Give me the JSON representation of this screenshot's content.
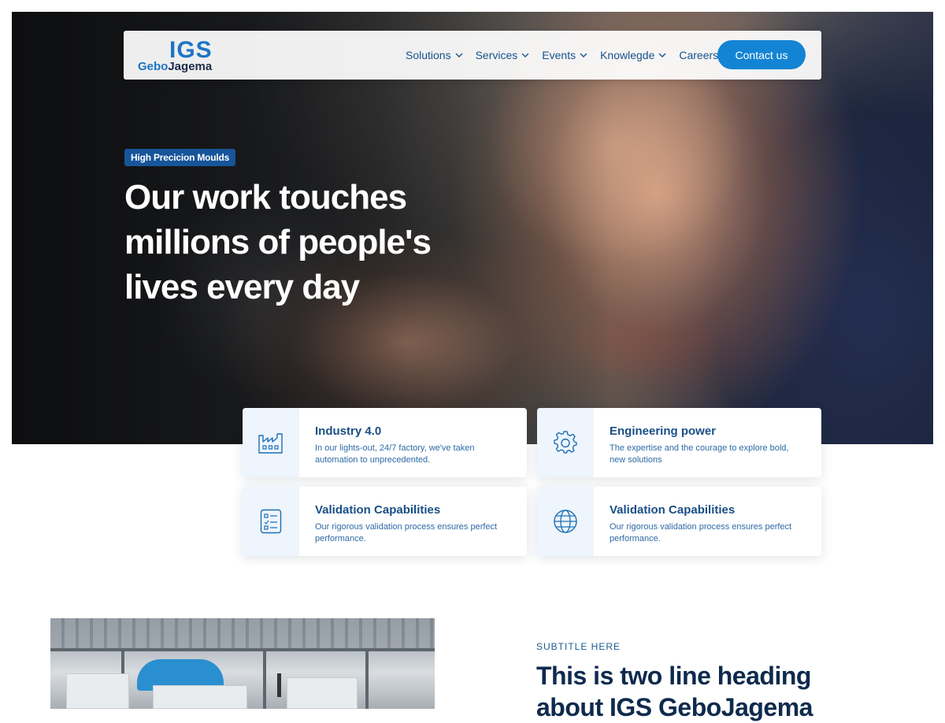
{
  "header": {
    "logo_mark": "IGS",
    "logo_word_part1": "Gebo",
    "logo_word_part2": "Jagema",
    "nav": [
      {
        "label": "Solutions"
      },
      {
        "label": "Services"
      },
      {
        "label": "Events"
      },
      {
        "label": "Knowlegde"
      },
      {
        "label": "Careers"
      }
    ],
    "contact_label": "Contact us"
  },
  "hero": {
    "badge": "High Precicion Moulds",
    "title": "Our work touches millions of people's lives every day"
  },
  "features": [
    {
      "title": "Industry 4.0",
      "description": "In our lights-out, 24/7 factory, we've taken automation to unprecedented.",
      "icon": "factory-icon"
    },
    {
      "title": "Engineering power",
      "description": "The expertise and the courage to explore bold, new solutions",
      "icon": "gear-icon"
    },
    {
      "title": "Validation Capabilities",
      "description": "Our rigorous validation process ensures perfect performance.",
      "icon": "checklist-icon"
    },
    {
      "title": "Validation Capabilities",
      "description": "Our rigorous validation process ensures perfect performance.",
      "icon": "globe-icon"
    }
  ],
  "about": {
    "subtitle": "SUBTITLE HERE",
    "heading": "This is two line heading about IGS GeboJagema"
  },
  "colors": {
    "accent": "#1384d4",
    "nav_text": "#17538c",
    "badge_bg": "#17559a",
    "heading": "#0e2a4d"
  }
}
